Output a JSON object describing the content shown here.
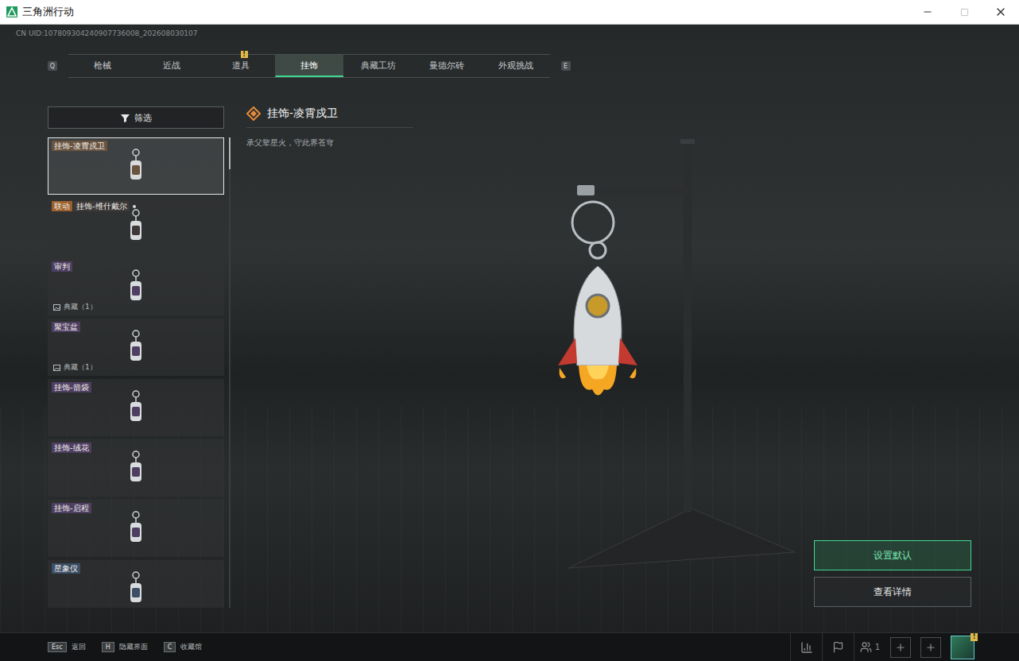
{
  "window": {
    "title": "三角洲行动"
  },
  "uid": "CN UID:107809304240907736008_202608030107",
  "tabs": {
    "prev_key": "Q",
    "next_key": "E",
    "items": [
      {
        "label": "枪械",
        "selected": false,
        "badge": ""
      },
      {
        "label": "近战",
        "selected": false,
        "badge": ""
      },
      {
        "label": "道具",
        "selected": false,
        "badge": "!"
      },
      {
        "label": "挂饰",
        "selected": true,
        "badge": ""
      },
      {
        "label": "典藏工坊",
        "selected": false,
        "badge": ""
      },
      {
        "label": "曼德尔砖",
        "selected": false,
        "badge": ""
      },
      {
        "label": "外观挑战",
        "selected": false,
        "badge": ""
      }
    ]
  },
  "filter": {
    "label": "筛选"
  },
  "items": [
    {
      "tags": [
        {
          "text": "挂饰-凌霄戍卫",
          "color": "#6a5440"
        }
      ],
      "note": "",
      "new": false,
      "selected": true
    },
    {
      "tags": [
        {
          "text": "联动",
          "color": "#9a5f2a"
        },
        {
          "text": "挂饰-维什戴尔",
          "color": "#3c3938"
        }
      ],
      "note": "",
      "new": true,
      "selected": false
    },
    {
      "tags": [
        {
          "text": "审判",
          "color": "#4e3f62"
        }
      ],
      "note": "典藏（1）",
      "new": false,
      "selected": false
    },
    {
      "tags": [
        {
          "text": "聚宝盆",
          "color": "#4e3f62"
        }
      ],
      "note": "典藏（1）",
      "new": false,
      "selected": false
    },
    {
      "tags": [
        {
          "text": "挂饰-箭袋",
          "color": "#4e3f62"
        }
      ],
      "note": "",
      "new": false,
      "selected": false
    },
    {
      "tags": [
        {
          "text": "挂饰-绒花",
          "color": "#4e3f62"
        }
      ],
      "note": "",
      "new": false,
      "selected": false
    },
    {
      "tags": [
        {
          "text": "挂饰-启程",
          "color": "#4e3f62"
        }
      ],
      "note": "",
      "new": false,
      "selected": false
    },
    {
      "tags": [
        {
          "text": "星象仪",
          "color": "#3d4f66"
        }
      ],
      "note": "",
      "new": false,
      "selected": false
    }
  ],
  "detail": {
    "title": "挂饰-凌霄戍卫",
    "description": "承父辈星火，守此界苍穹"
  },
  "actions": [
    {
      "label": "设置默认",
      "selected": true
    },
    {
      "label": "查看详情",
      "selected": false
    }
  ],
  "footer": {
    "hints": [
      {
        "key": "Esc",
        "label": "返回"
      },
      {
        "key": "H",
        "label": "隐藏界面"
      },
      {
        "key": "C",
        "label": "收藏馆"
      }
    ],
    "friends_count": "1",
    "avatar_badge": "!"
  }
}
